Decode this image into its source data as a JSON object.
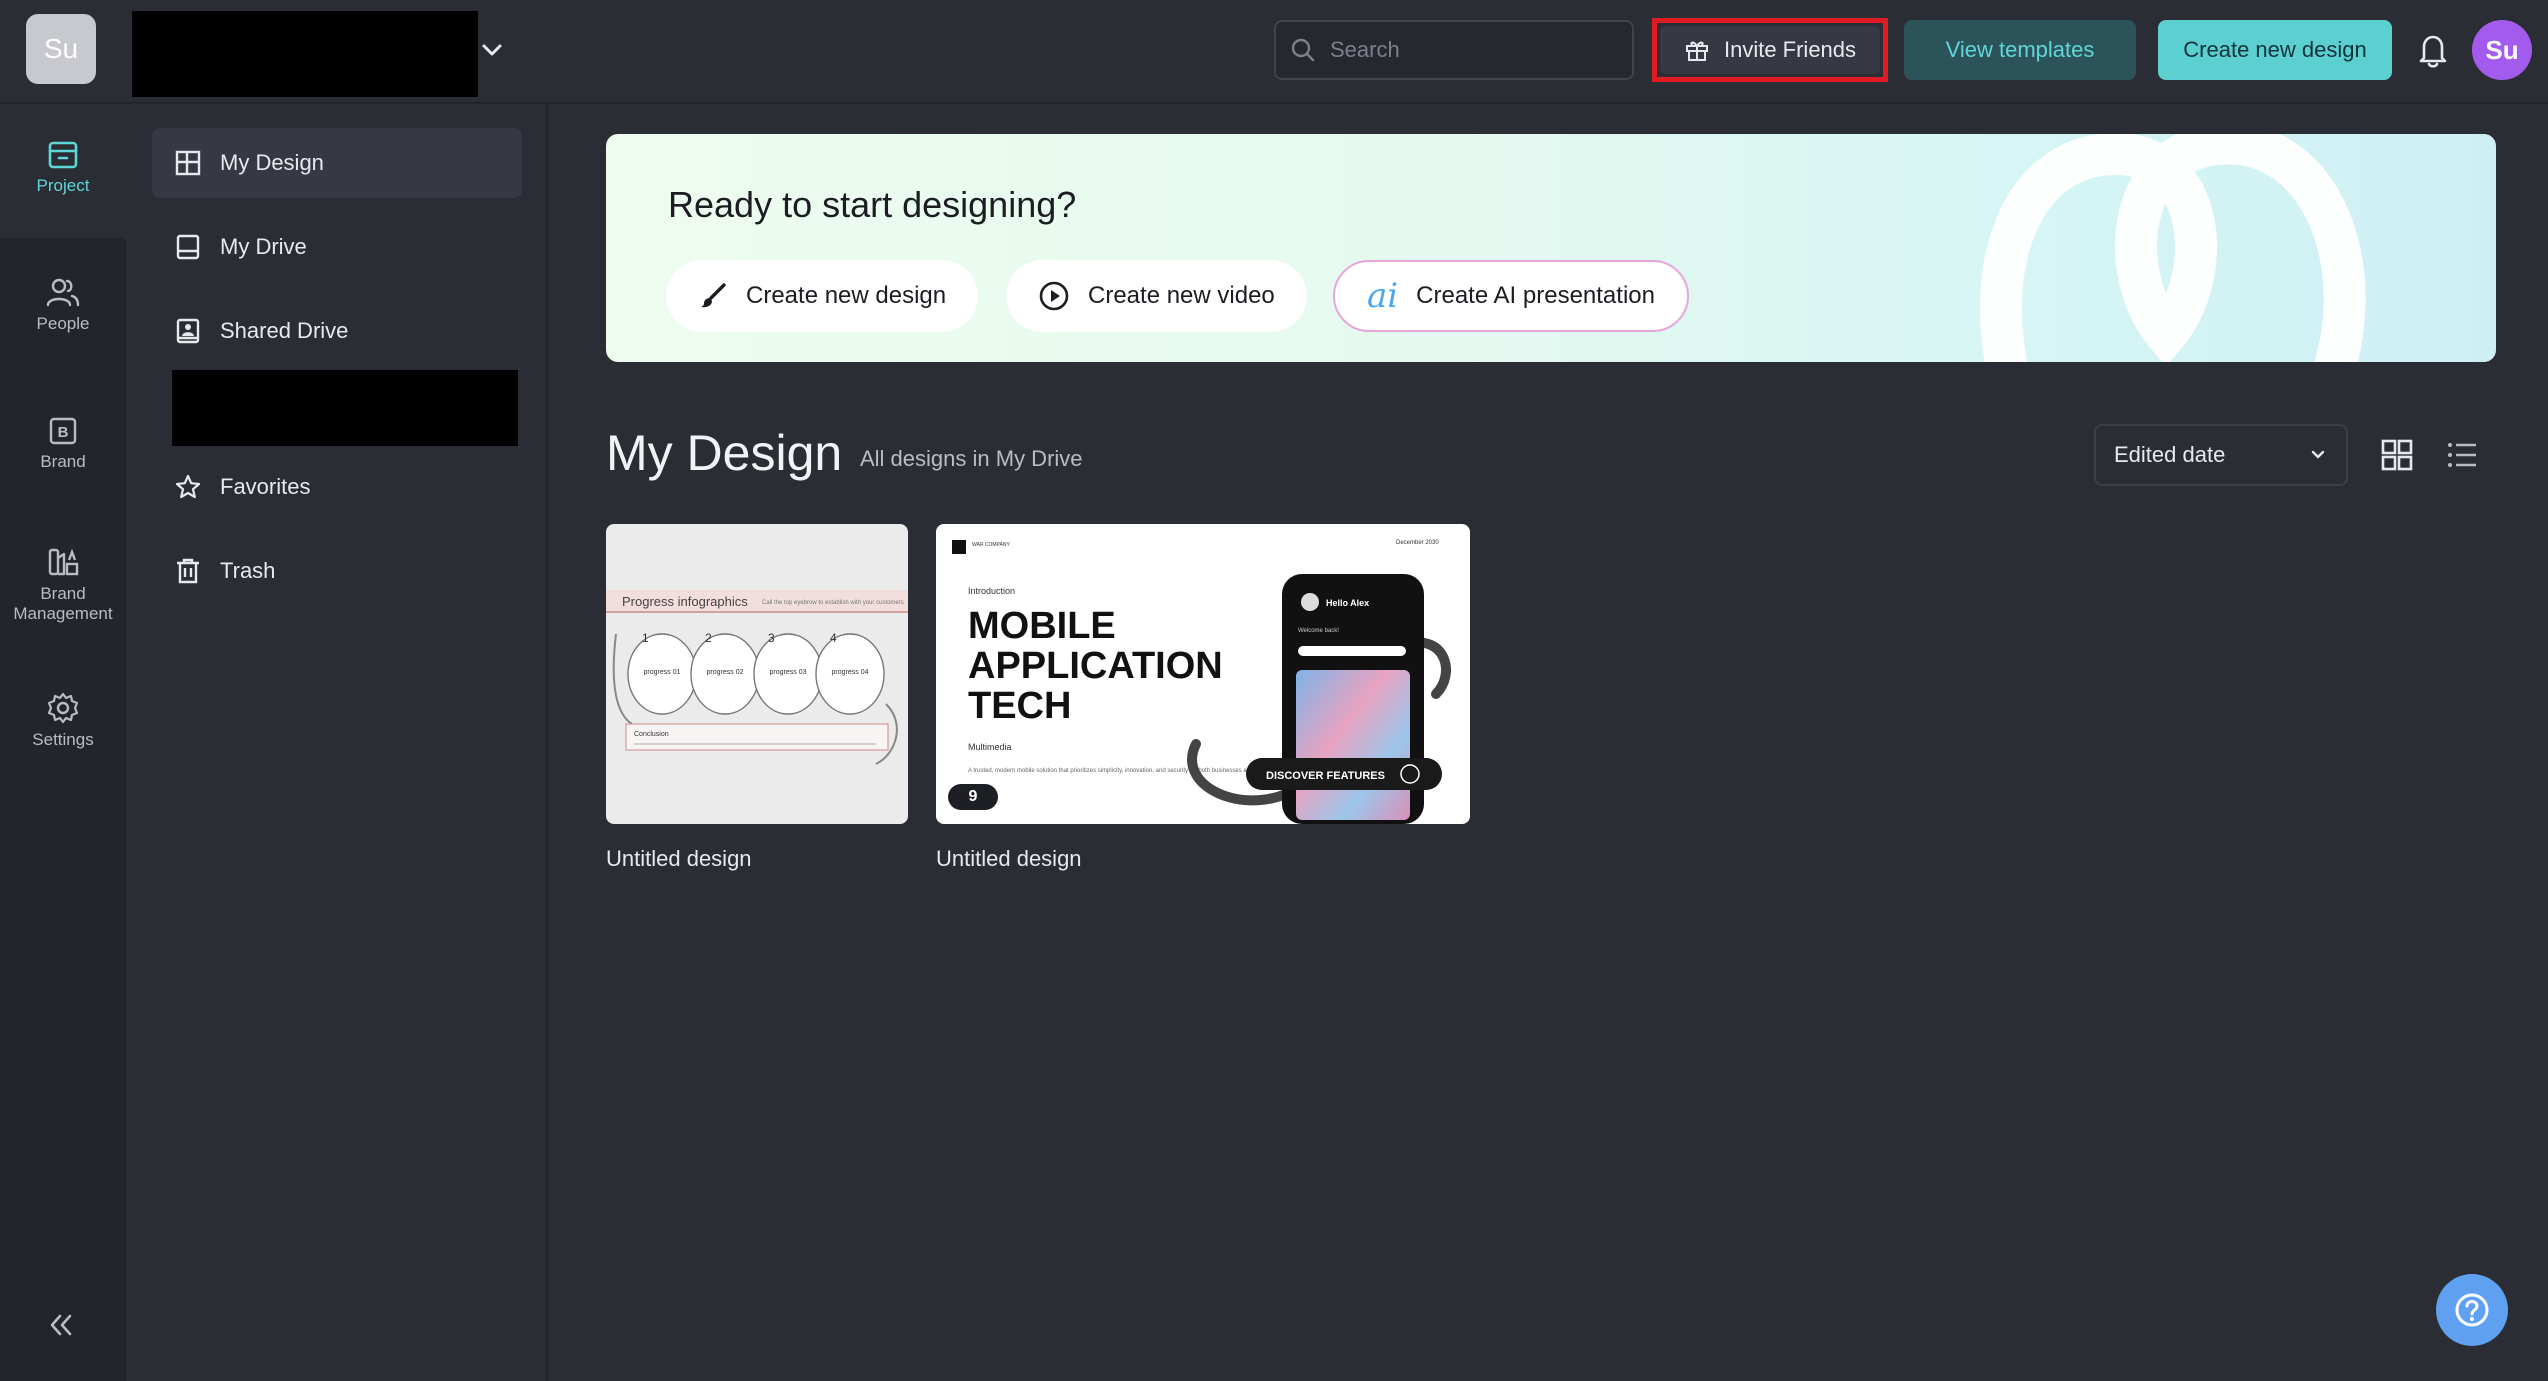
{
  "workspace": {
    "avatar_text": "Su"
  },
  "search": {
    "placeholder": "Search"
  },
  "header": {
    "invite_label": "Invite Friends",
    "templates_label": "View templates",
    "create_label": "Create new design",
    "user_initials": "Su"
  },
  "rail": {
    "items": [
      {
        "label": "Project",
        "icon": "project-icon"
      },
      {
        "label": "People",
        "icon": "people-icon"
      },
      {
        "label": "Brand",
        "icon": "brand-icon"
      },
      {
        "label": "Brand Management",
        "icon": "brand-management-icon"
      },
      {
        "label": "Settings",
        "icon": "settings-icon"
      }
    ]
  },
  "sidebar": {
    "items": [
      {
        "label": "My Design",
        "icon": "layout-icon"
      },
      {
        "label": "My Drive",
        "icon": "drive-icon"
      },
      {
        "label": "Shared Drive",
        "icon": "shared-drive-icon"
      },
      {
        "label": "Favorites",
        "icon": "star-icon"
      },
      {
        "label": "Trash",
        "icon": "trash-icon"
      }
    ]
  },
  "banner": {
    "title": "Ready to start designing?",
    "actions": [
      {
        "label": "Create new design",
        "icon": "brush-icon"
      },
      {
        "label": "Create new video",
        "icon": "play-icon"
      },
      {
        "label": "Create AI presentation",
        "icon": "ai-icon"
      }
    ]
  },
  "main": {
    "title": "My Design",
    "subtitle": "All designs in My Drive",
    "sort_value": "Edited date"
  },
  "designs": [
    {
      "name": "Untitled design",
      "thumb": {
        "heading": "Progress infographics",
        "blurb": "Call the top eyebrow to establish with your customers",
        "steps": [
          "1",
          "2",
          "3",
          "4"
        ],
        "step_labels": [
          "progress 01",
          "progress 02",
          "progress 03",
          "progress 04"
        ],
        "conclusion": "Conclusion"
      }
    },
    {
      "name": "Untitled design",
      "page_count": "9",
      "thumb": {
        "company": "WAR COMPANY",
        "date": "December 2030",
        "intro": "Introduction",
        "headline": [
          "MOBILE",
          "APPLICATION",
          "TECH"
        ],
        "subhead": "Multimedia",
        "body": "A trusted, modern mobile solution that prioritizes simplicity, innovation, and security for both businesses and end users.",
        "phone_greeting": "Hello Alex",
        "phone_welcome": "Welcome back!",
        "cta": "DISCOVER FEATURES"
      }
    }
  ],
  "colors": {
    "accent": "#5ccfd1",
    "highlight_border": "#e01b24",
    "avatar": "#a35bee"
  }
}
